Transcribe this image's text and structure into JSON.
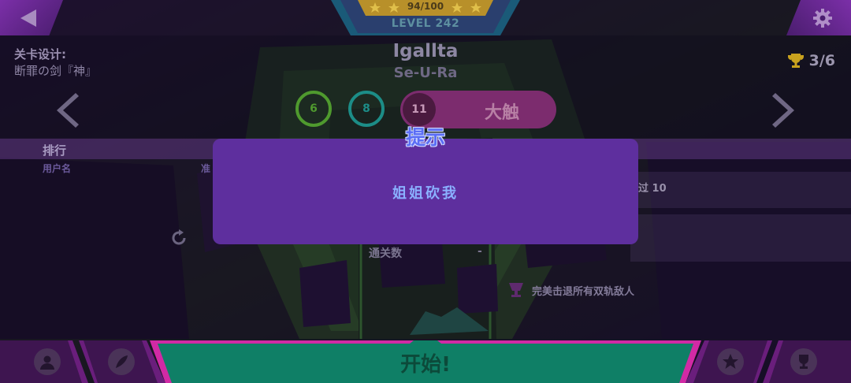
{
  "level": {
    "progress": "94/100",
    "label": "LEVEL 242"
  },
  "designer": {
    "label": "关卡设计:",
    "name": "断罪の剑『神』"
  },
  "song": {
    "title": "Igallta",
    "artist": "Se-U-Ra"
  },
  "trophies": {
    "count": "3/6"
  },
  "difficulties": [
    {
      "level": "6",
      "color": "#4f9a2e"
    },
    {
      "level": "8",
      "color": "#1c8d87"
    },
    {
      "level": "11",
      "label": "大触",
      "color": "#7c2c6e",
      "selected": true
    }
  ],
  "ranking": {
    "title": "排行",
    "col_user": "用户名",
    "col_acc": "准"
  },
  "stats": {
    "clears_label": "通关数",
    "clears_value": "-"
  },
  "missions": [
    {
      "text": "过 10"
    },
    {
      "text": "完美击退所有双轨敌人"
    }
  ],
  "start": {
    "label": "开始!"
  },
  "dialog": {
    "title": "提示",
    "message": "姐姐砍我"
  },
  "icons": {
    "back": "back-arrow-icon",
    "settings": "gear-icon",
    "trophy": "trophy-icon",
    "refresh": "refresh-icon",
    "profile": "profile-icon",
    "feather": "feather-icon",
    "star": "star-icon",
    "cup": "cup-icon"
  },
  "colors": {
    "dialog_bg": "#5e2f9e",
    "dialog_title": "#5b6ef5",
    "dialog_message": "#8ab0ff",
    "start_button": "#0f7f66",
    "accent_pink": "#d12aa5"
  }
}
